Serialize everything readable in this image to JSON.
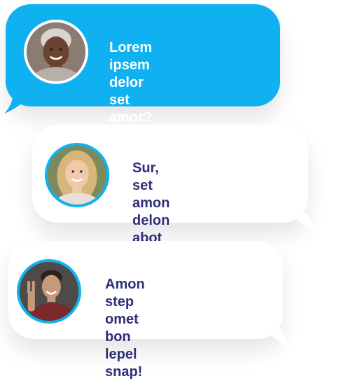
{
  "colors": {
    "accent_blue": "#0fb1f0",
    "text_dark": "#2f2f7a",
    "bubble_white": "#ffffff"
  },
  "messages": [
    {
      "text": "Lorem ipsem delor\nset amor?",
      "avatar": "woman-short-hair-avatar",
      "style": "blue"
    },
    {
      "text": "Sur, set amon delon\nabot um letpel.",
      "avatar": "woman-blonde-avatar",
      "style": "white"
    },
    {
      "text": "Amon step omet\nbon lepel snap!",
      "avatar": "man-peace-sign-avatar",
      "style": "white"
    }
  ]
}
